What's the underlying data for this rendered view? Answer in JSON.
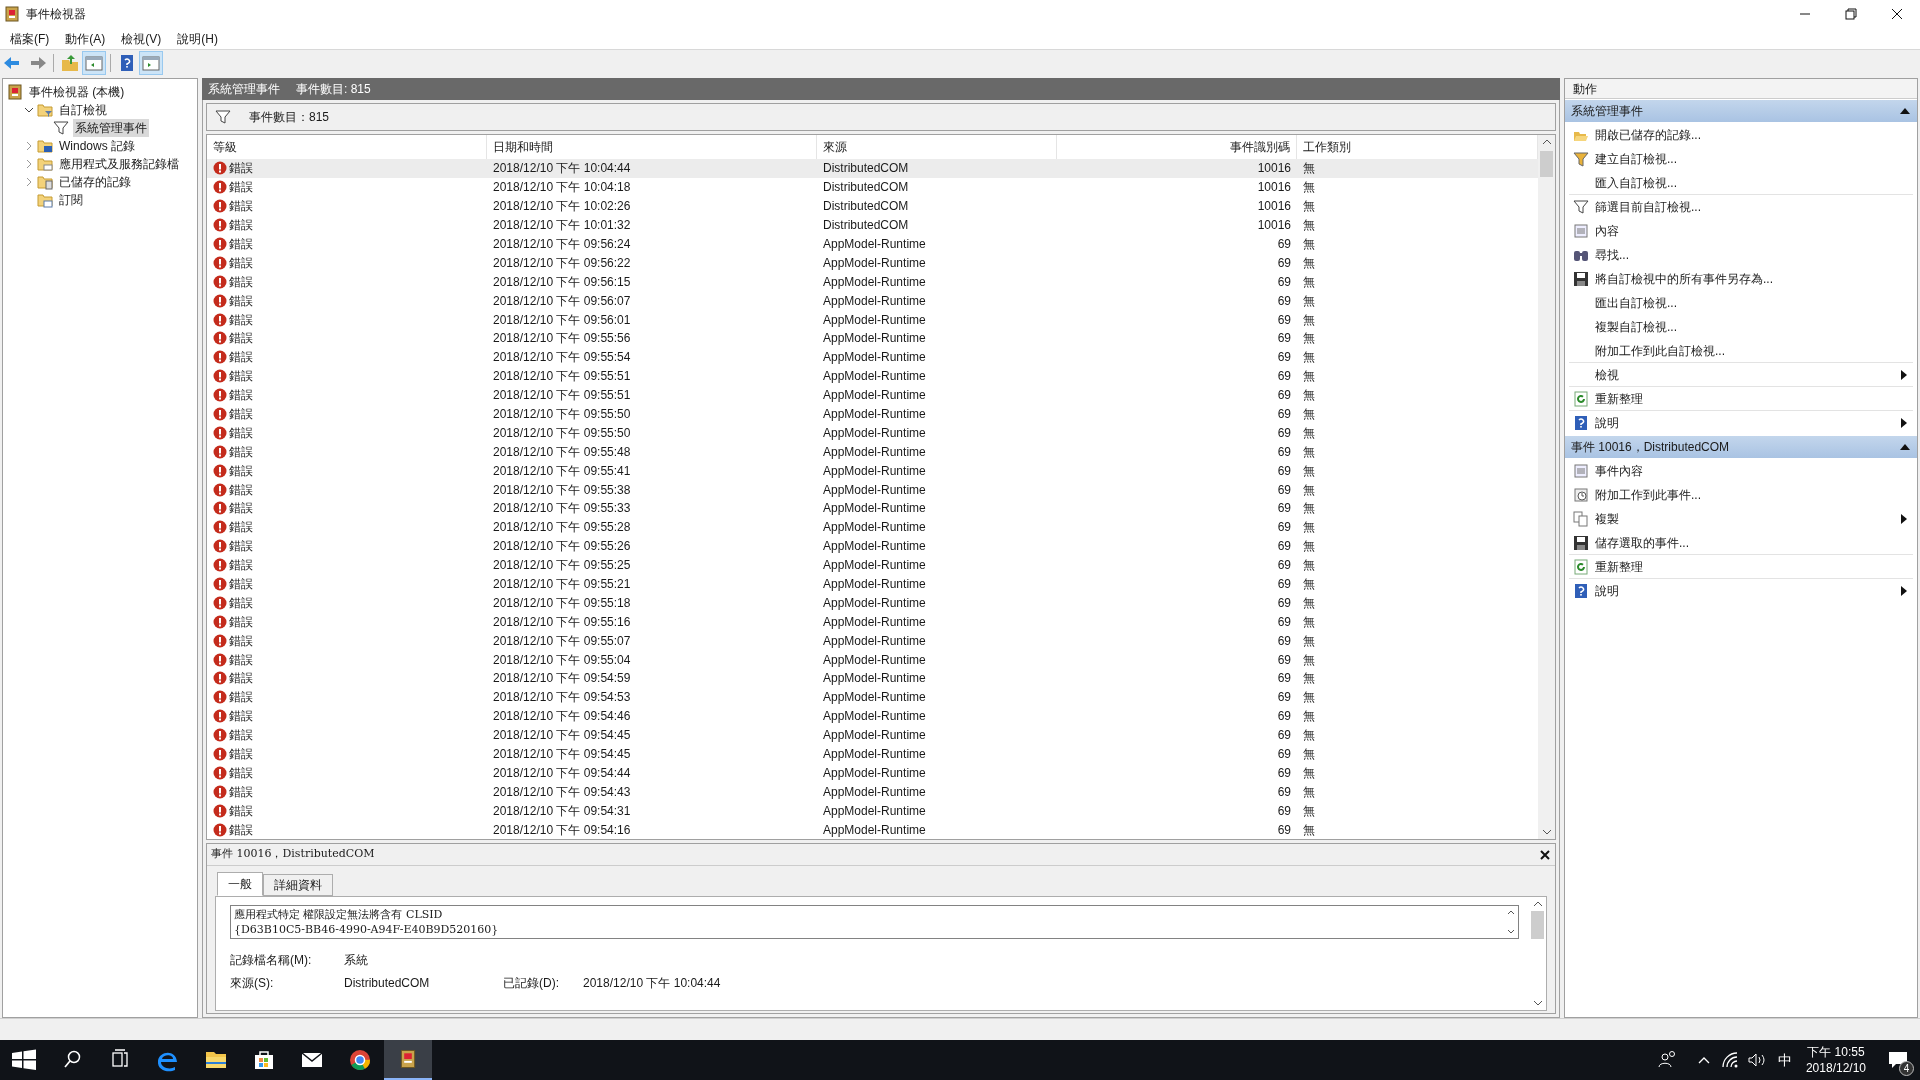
{
  "window": {
    "title": "事件檢視器"
  },
  "menu": [
    "檔案(F)",
    "動作(A)",
    "檢視(V)",
    "說明(H)"
  ],
  "toolbar": [
    {
      "kind": "back"
    },
    {
      "kind": "forward"
    },
    {
      "kind": "separator"
    },
    {
      "kind": "up"
    },
    {
      "kind": "tree-toggle",
      "on": true
    },
    {
      "kind": "separator"
    },
    {
      "kind": "help"
    },
    {
      "kind": "pane-toggle",
      "on": true
    }
  ],
  "tree": {
    "label": "事件檢視器 (本機)",
    "kind": "viewer",
    "selected": false,
    "children": [
      {
        "label": "自訂檢視",
        "kind": "filter-folder",
        "expanded": true,
        "selected": false,
        "children": [
          {
            "label": "系統管理事件",
            "kind": "filter",
            "selected": true
          }
        ]
      },
      {
        "label": "Windows 記錄",
        "kind": "windows-folder",
        "expanded": false,
        "selected": false
      },
      {
        "label": "應用程式及服務記錄檔",
        "kind": "folder",
        "expanded": false,
        "selected": false
      },
      {
        "label": "已儲存的記錄",
        "kind": "log-folder",
        "expanded": false,
        "selected": false
      },
      {
        "label": "訂閱",
        "kind": "sub-folder",
        "selected": false
      }
    ]
  },
  "view_header": {
    "title": "系統管理事件",
    "count": "事件數目: 815"
  },
  "filter_bar": {
    "text": "事件數目：815"
  },
  "table": {
    "columns": [
      "等級",
      "日期和時間",
      "來源",
      "事件識別碼",
      "工作類別"
    ],
    "rows": [
      {
        "level": "錯誤",
        "kind": "error",
        "datetime": "2018/12/10 下午 10:04:44",
        "source": "DistributedCOM",
        "event_id": "10016",
        "category": "無",
        "selected": true
      },
      {
        "level": "錯誤",
        "kind": "error",
        "datetime": "2018/12/10 下午 10:04:18",
        "source": "DistributedCOM",
        "event_id": "10016",
        "category": "無",
        "selected": false
      },
      {
        "level": "錯誤",
        "kind": "error",
        "datetime": "2018/12/10 下午 10:02:26",
        "source": "DistributedCOM",
        "event_id": "10016",
        "category": "無",
        "selected": false
      },
      {
        "level": "錯誤",
        "kind": "error",
        "datetime": "2018/12/10 下午 10:01:32",
        "source": "DistributedCOM",
        "event_id": "10016",
        "category": "無",
        "selected": false
      },
      {
        "level": "錯誤",
        "kind": "error",
        "datetime": "2018/12/10 下午 09:56:24",
        "source": "AppModel-Runtime",
        "event_id": "69",
        "category": "無",
        "selected": false
      },
      {
        "level": "錯誤",
        "kind": "error",
        "datetime": "2018/12/10 下午 09:56:22",
        "source": "AppModel-Runtime",
        "event_id": "69",
        "category": "無",
        "selected": false
      },
      {
        "level": "錯誤",
        "kind": "error",
        "datetime": "2018/12/10 下午 09:56:15",
        "source": "AppModel-Runtime",
        "event_id": "69",
        "category": "無",
        "selected": false
      },
      {
        "level": "錯誤",
        "kind": "error",
        "datetime": "2018/12/10 下午 09:56:07",
        "source": "AppModel-Runtime",
        "event_id": "69",
        "category": "無",
        "selected": false
      },
      {
        "level": "錯誤",
        "kind": "error",
        "datetime": "2018/12/10 下午 09:56:01",
        "source": "AppModel-Runtime",
        "event_id": "69",
        "category": "無",
        "selected": false
      },
      {
        "level": "錯誤",
        "kind": "error",
        "datetime": "2018/12/10 下午 09:55:56",
        "source": "AppModel-Runtime",
        "event_id": "69",
        "category": "無",
        "selected": false
      },
      {
        "level": "錯誤",
        "kind": "error",
        "datetime": "2018/12/10 下午 09:55:54",
        "source": "AppModel-Runtime",
        "event_id": "69",
        "category": "無",
        "selected": false
      },
      {
        "level": "錯誤",
        "kind": "error",
        "datetime": "2018/12/10 下午 09:55:51",
        "source": "AppModel-Runtime",
        "event_id": "69",
        "category": "無",
        "selected": false
      },
      {
        "level": "錯誤",
        "kind": "error",
        "datetime": "2018/12/10 下午 09:55:51",
        "source": "AppModel-Runtime",
        "event_id": "69",
        "category": "無",
        "selected": false
      },
      {
        "level": "錯誤",
        "kind": "error",
        "datetime": "2018/12/10 下午 09:55:50",
        "source": "AppModel-Runtime",
        "event_id": "69",
        "category": "無",
        "selected": false
      },
      {
        "level": "錯誤",
        "kind": "error",
        "datetime": "2018/12/10 下午 09:55:50",
        "source": "AppModel-Runtime",
        "event_id": "69",
        "category": "無",
        "selected": false
      },
      {
        "level": "錯誤",
        "kind": "error",
        "datetime": "2018/12/10 下午 09:55:48",
        "source": "AppModel-Runtime",
        "event_id": "69",
        "category": "無",
        "selected": false
      },
      {
        "level": "錯誤",
        "kind": "error",
        "datetime": "2018/12/10 下午 09:55:41",
        "source": "AppModel-Runtime",
        "event_id": "69",
        "category": "無",
        "selected": false
      },
      {
        "level": "錯誤",
        "kind": "error",
        "datetime": "2018/12/10 下午 09:55:38",
        "source": "AppModel-Runtime",
        "event_id": "69",
        "category": "無",
        "selected": false
      },
      {
        "level": "錯誤",
        "kind": "error",
        "datetime": "2018/12/10 下午 09:55:33",
        "source": "AppModel-Runtime",
        "event_id": "69",
        "category": "無",
        "selected": false
      },
      {
        "level": "錯誤",
        "kind": "error",
        "datetime": "2018/12/10 下午 09:55:28",
        "source": "AppModel-Runtime",
        "event_id": "69",
        "category": "無",
        "selected": false
      },
      {
        "level": "錯誤",
        "kind": "error",
        "datetime": "2018/12/10 下午 09:55:26",
        "source": "AppModel-Runtime",
        "event_id": "69",
        "category": "無",
        "selected": false
      },
      {
        "level": "錯誤",
        "kind": "error",
        "datetime": "2018/12/10 下午 09:55:25",
        "source": "AppModel-Runtime",
        "event_id": "69",
        "category": "無",
        "selected": false
      },
      {
        "level": "錯誤",
        "kind": "error",
        "datetime": "2018/12/10 下午 09:55:21",
        "source": "AppModel-Runtime",
        "event_id": "69",
        "category": "無",
        "selected": false
      },
      {
        "level": "錯誤",
        "kind": "error",
        "datetime": "2018/12/10 下午 09:55:18",
        "source": "AppModel-Runtime",
        "event_id": "69",
        "category": "無",
        "selected": false
      },
      {
        "level": "錯誤",
        "kind": "error",
        "datetime": "2018/12/10 下午 09:55:16",
        "source": "AppModel-Runtime",
        "event_id": "69",
        "category": "無",
        "selected": false
      },
      {
        "level": "錯誤",
        "kind": "error",
        "datetime": "2018/12/10 下午 09:55:07",
        "source": "AppModel-Runtime",
        "event_id": "69",
        "category": "無",
        "selected": false
      },
      {
        "level": "錯誤",
        "kind": "error",
        "datetime": "2018/12/10 下午 09:55:04",
        "source": "AppModel-Runtime",
        "event_id": "69",
        "category": "無",
        "selected": false
      },
      {
        "level": "錯誤",
        "kind": "error",
        "datetime": "2018/12/10 下午 09:54:59",
        "source": "AppModel-Runtime",
        "event_id": "69",
        "category": "無",
        "selected": false
      },
      {
        "level": "錯誤",
        "kind": "error",
        "datetime": "2018/12/10 下午 09:54:53",
        "source": "AppModel-Runtime",
        "event_id": "69",
        "category": "無",
        "selected": false
      },
      {
        "level": "錯誤",
        "kind": "error",
        "datetime": "2018/12/10 下午 09:54:46",
        "source": "AppModel-Runtime",
        "event_id": "69",
        "category": "無",
        "selected": false
      },
      {
        "level": "錯誤",
        "kind": "error",
        "datetime": "2018/12/10 下午 09:54:45",
        "source": "AppModel-Runtime",
        "event_id": "69",
        "category": "無",
        "selected": false
      },
      {
        "level": "錯誤",
        "kind": "error",
        "datetime": "2018/12/10 下午 09:54:45",
        "source": "AppModel-Runtime",
        "event_id": "69",
        "category": "無",
        "selected": false
      },
      {
        "level": "錯誤",
        "kind": "error",
        "datetime": "2018/12/10 下午 09:54:44",
        "source": "AppModel-Runtime",
        "event_id": "69",
        "category": "無",
        "selected": false
      },
      {
        "level": "錯誤",
        "kind": "error",
        "datetime": "2018/12/10 下午 09:54:43",
        "source": "AppModel-Runtime",
        "event_id": "69",
        "category": "無",
        "selected": false
      },
      {
        "level": "錯誤",
        "kind": "error",
        "datetime": "2018/12/10 下午 09:54:31",
        "source": "AppModel-Runtime",
        "event_id": "69",
        "category": "無",
        "selected": false
      },
      {
        "level": "錯誤",
        "kind": "error",
        "datetime": "2018/12/10 下午 09:54:16",
        "source": "AppModel-Runtime",
        "event_id": "69",
        "category": "無",
        "selected": false
      }
    ]
  },
  "detail": {
    "title": "事件 10016，DistributedCOM",
    "tabs": [
      {
        "label": "一般",
        "selected": true
      },
      {
        "label": "詳細資料",
        "selected": false
      }
    ],
    "message": [
      "應用程式特定 權限設定無法將含有 CLSID",
      "{D63B10C5-BB46-4990-A94F-E40B9D520160}"
    ],
    "fields": [
      [
        {
          "label": "記錄檔名稱(M):",
          "value": "系統"
        }
      ],
      [
        {
          "label": "來源(S):",
          "value": "DistributedCOM"
        },
        {
          "label": "已記錄(D):",
          "value": "2018/12/10 下午 10:04:44"
        }
      ]
    ]
  },
  "actions": {
    "title": "動作",
    "sections": [
      {
        "title": "系統管理事件",
        "expanded": true,
        "items": [
          {
            "label": "開啟已儲存的記錄...",
            "kind": "open"
          },
          {
            "label": "建立自訂檢視...",
            "kind": "filter-new"
          },
          {
            "label": "匯入自訂檢視...",
            "divider": true
          },
          {
            "label": "篩選目前自訂檢視...",
            "kind": "filter"
          },
          {
            "label": "內容",
            "kind": "properties"
          },
          {
            "label": "尋找...",
            "kind": "find"
          },
          {
            "label": "將自訂檢視中的所有事件另存為...",
            "kind": "save"
          },
          {
            "label": "匯出自訂檢視..."
          },
          {
            "label": "複製自訂檢視..."
          },
          {
            "label": "附加工作到此自訂檢視...",
            "divider": true
          },
          {
            "label": "檢視",
            "submenu": true,
            "divider": true
          },
          {
            "label": "重新整理",
            "kind": "refresh",
            "divider": true
          },
          {
            "label": "說明",
            "kind": "help",
            "submenu": true
          }
        ]
      },
      {
        "title": "事件 10016，DistributedCOM",
        "expanded": true,
        "items": [
          {
            "label": "事件內容",
            "kind": "properties"
          },
          {
            "label": "附加工作到此事件...",
            "kind": "task"
          },
          {
            "label": "複製",
            "kind": "copy",
            "submenu": true
          },
          {
            "label": "儲存選取的事件...",
            "kind": "save",
            "divider": true
          },
          {
            "label": "重新整理",
            "kind": "refresh",
            "divider": true
          },
          {
            "label": "說明",
            "kind": "help",
            "submenu": true
          }
        ]
      }
    ]
  },
  "taskbar": {
    "apps": [
      {
        "kind": "start"
      },
      {
        "kind": "search"
      },
      {
        "kind": "task-view"
      },
      {
        "kind": "edge"
      },
      {
        "kind": "explorer"
      },
      {
        "kind": "store"
      },
      {
        "kind": "mail"
      },
      {
        "kind": "chrome"
      },
      {
        "kind": "event-viewer",
        "active": true
      }
    ],
    "ime": "中",
    "time": "下午 10:55",
    "date": "2018/12/10",
    "notifications": "4"
  }
}
